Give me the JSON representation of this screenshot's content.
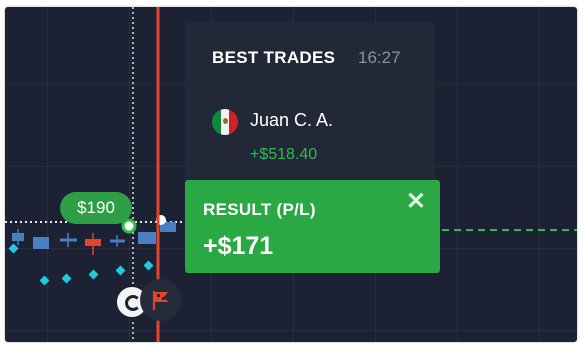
{
  "best_trades": {
    "title": "BEST TRADES",
    "time": "16:27",
    "trader": {
      "name": "Juan C. A.",
      "profit": "+$518.40",
      "flag_icon": "mexico-flag-icon"
    }
  },
  "result": {
    "title": "RESULT (P/L)",
    "value": "+$171",
    "close_icon": "close-icon"
  },
  "price_badge": "$190",
  "colors": {
    "background": "#1c2133",
    "panel": "#222837",
    "result_green": "#29a843",
    "profit_green": "#2ebd4a",
    "deadline_line": "#e4442a",
    "marker_cyan": "#22c9e0",
    "candle_blue": "#4a7fc4",
    "candle_red": "#e0442c"
  }
}
